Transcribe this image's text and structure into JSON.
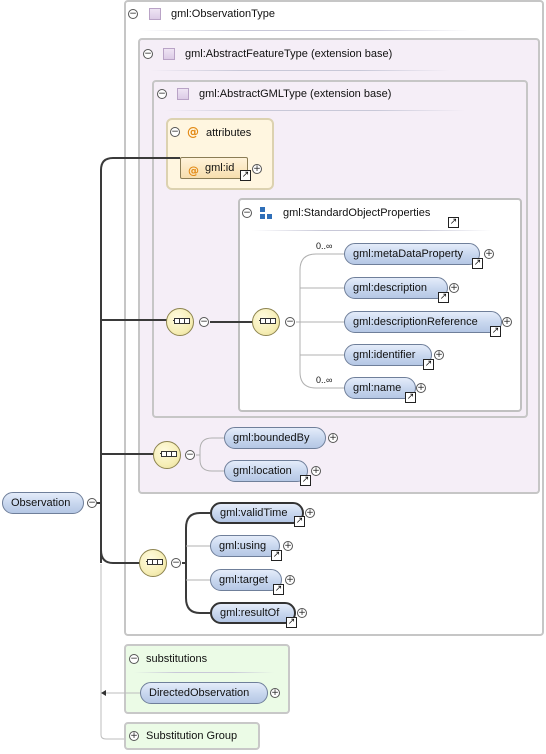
{
  "root": {
    "label": "Observation"
  },
  "observation_type": {
    "label": "gml:ObservationType"
  },
  "abstract_feature": {
    "label": "gml:AbstractFeatureType (extension base)"
  },
  "abstract_gml": {
    "label": "gml:AbstractGMLType (extension base)"
  },
  "attributes": {
    "label": "attributes",
    "items": [
      "gml:id"
    ]
  },
  "standard_object": {
    "label": "gml:StandardObjectProperties",
    "elements": [
      {
        "label": "gml:metaDataProperty",
        "cardinality": "0..∞"
      },
      {
        "label": "gml:description",
        "cardinality": ""
      },
      {
        "label": "gml:descriptionReference",
        "cardinality": ""
      },
      {
        "label": "gml:identifier",
        "cardinality": ""
      },
      {
        "label": "gml:name",
        "cardinality": "0..∞"
      }
    ]
  },
  "feature_elements": [
    "gml:boundedBy",
    "gml:location"
  ],
  "observation_elements": [
    "gml:validTime",
    "gml:using",
    "gml:target",
    "gml:resultOf"
  ],
  "substitutions": {
    "label": "substitutions",
    "items": [
      "DirectedObservation"
    ]
  },
  "substitution_group": {
    "label": "Substitution Group"
  },
  "colors": {
    "element_fill": "#c7d6ee",
    "attribute_fill": "#fff6e0",
    "extension_fill": "#f5eef7",
    "substitution_fill": "#ebfbe6",
    "sequence_fill": "#f6eeb6"
  },
  "icons": {
    "type_icon": "square-type-icon",
    "attribute_icon": "at-sign-icon",
    "group_icon": "model-group-icon",
    "sequence_icon": "sequence-compositor-icon",
    "reference_icon": "arrow-ne-icon",
    "expand_icon": "plus-circle-icon",
    "collapse_icon": "minus-circle-icon"
  }
}
